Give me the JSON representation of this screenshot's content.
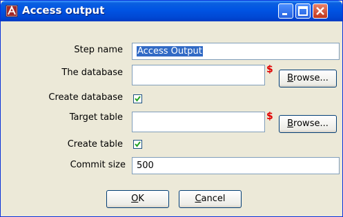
{
  "window": {
    "title": "Access output"
  },
  "form": {
    "step_name": {
      "label": "Step name",
      "value": "Access Output"
    },
    "database": {
      "label": "The database",
      "value": "",
      "browse": {
        "first": "B",
        "rest": "rowse..."
      }
    },
    "create_database": {
      "label": "Create database",
      "checked": true
    },
    "target_table": {
      "label": "Target table",
      "value": "",
      "browse": {
        "first": "B",
        "rest": "rowse..."
      }
    },
    "create_table": {
      "label": "Create table",
      "checked": true
    },
    "commit_size": {
      "label": "Commit size",
      "value": "500"
    }
  },
  "required_marker": "$",
  "buttons": {
    "ok": {
      "first": "O",
      "rest": "K"
    },
    "cancel": {
      "first": "C",
      "rest": "ancel"
    }
  },
  "icons": {
    "app": "access-app-icon",
    "minimize": "minimize-icon",
    "maximize": "maximize-icon",
    "close": "close-icon",
    "checkmark": "check-icon"
  },
  "colors": {
    "titlebar": "#0054e3",
    "selection": "#316ac5",
    "required": "#e00000",
    "check": "#21a121"
  }
}
